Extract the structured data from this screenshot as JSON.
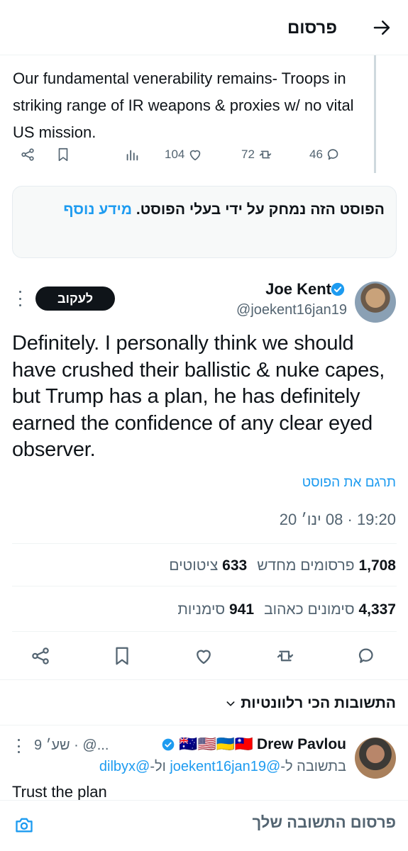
{
  "header": {
    "title": "פרסום",
    "back_icon": "arrow-right-icon"
  },
  "quoted": {
    "text": "Our fundamental venerability remains- Troops in striking range of IR weapons & proxies w/ no vital US mission.",
    "views": "",
    "likes": "104",
    "reposts": "72",
    "replies": "46"
  },
  "notice": {
    "text": "הפוסט הזה נמחק על ידי בעלי הפוסט.",
    "link": "מידע נוסף"
  },
  "author": {
    "name": "Joe Kent",
    "handle": "@joekent16jan19",
    "follow_label": "לעקוב"
  },
  "post": {
    "text": "Definitely. I personally think we should have crushed their ballistic & nuke capes, but Trump has a plan, he has definitely earned the confidence of any clear eyed observer.",
    "translate": "תרגם את הפוסט",
    "timestamp": "19:20 · 08 ינו׳ 20"
  },
  "stats": {
    "reposts_count": "1,708",
    "reposts_label": "פרסומים מחדש",
    "quotes_count": "633",
    "quotes_label": "ציטוטים",
    "likes_count": "4,337",
    "likes_label": "סימונים כאהוב",
    "bookmarks_count": "941",
    "bookmarks_label": "סימניות"
  },
  "relevant_label": "התשובות הכי רלוונטיות",
  "reply": {
    "name": "Drew Pavlou",
    "flags": "🇦🇺🇺🇸🇺🇦🇹🇼",
    "meta": "9 שע׳ · @...",
    "reply_prefix": "בתשובה ל-",
    "mention1": "@joekent16jan19",
    "mention_join": " ול-",
    "mention2": "@dilbyx",
    "text": "Trust the plan"
  },
  "compose": {
    "placeholder": "פרסום התשובה שלך",
    "camera_icon": "camera-icon"
  },
  "colors": {
    "accent": "#1d9bf0",
    "text": "#0f1419",
    "muted": "#536471"
  }
}
